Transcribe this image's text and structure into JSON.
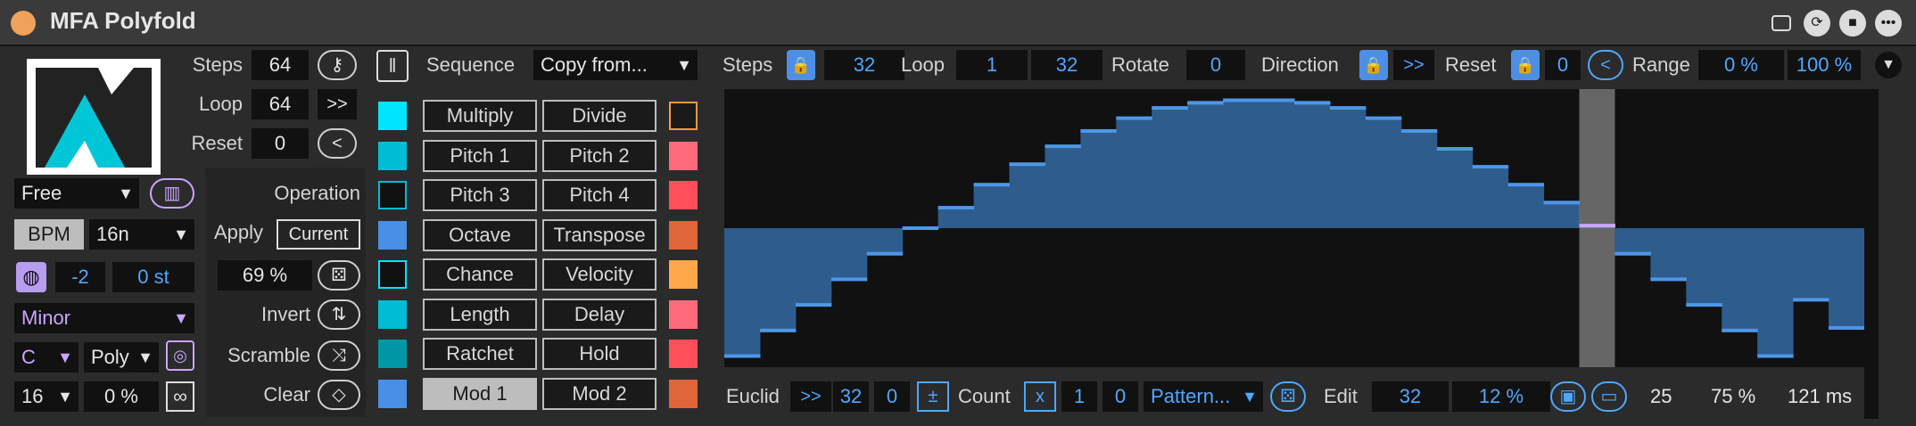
{
  "title": "MFA Polyfold",
  "colors": {
    "accent": "#4ea8ff",
    "bar": "#2e5c8c",
    "bar_top": "#4e97e8",
    "playhead": "#8a8a8a",
    "highlight": "#c9a6ff"
  },
  "left": {
    "steps_label": "Steps",
    "steps": "64",
    "loop_label": "Loop",
    "loop": "64",
    "loop_dir": ">>",
    "reset_label": "Reset",
    "reset": "0",
    "reset_dir": "<",
    "sync": "Free",
    "bpm": "BPM",
    "rate": "16n",
    "transpose": "-2",
    "semitones": "0 st",
    "scale": "Minor",
    "key": "C",
    "voice": "Poly",
    "length": "16",
    "percent": "0 %",
    "inf": "∞",
    "operation_label": "Operation",
    "apply_label": "Apply",
    "apply_value": "Current",
    "amount": "69 %",
    "invert_label": "Invert",
    "scramble_label": "Scramble",
    "clear_label": "Clear"
  },
  "sequence": {
    "label": "Sequence",
    "copy": "Copy from..."
  },
  "ops": [
    {
      "a": "Multiply",
      "b": "Divide",
      "ca": "#00e5ff",
      "cb": "#1a1a1a",
      "cbb": "#ff9a3c"
    },
    {
      "a": "Pitch 1",
      "b": "Pitch 2",
      "ca": "#00bcd4",
      "cb": "#ff6b7a"
    },
    {
      "a": "Pitch 3",
      "b": "Pitch 4",
      "ca": "#111111",
      "cab": "#00bcd4",
      "cb": "#ff4f5a"
    },
    {
      "a": "Octave",
      "b": "Transpose",
      "ca": "#4a8fe6",
      "cb": "#e0653a"
    },
    {
      "a": "Chance",
      "b": "Velocity",
      "ca": "#111111",
      "cab": "#00e5ff",
      "cb": "#ffa84a"
    },
    {
      "a": "Length",
      "b": "Delay",
      "ca": "#00bcd4",
      "cb": "#ff6b7a"
    },
    {
      "a": "Ratchet",
      "b": "Hold",
      "ca": "#0097a7",
      "cb": "#ff4f5a"
    },
    {
      "a": "Mod 1",
      "b": "Mod 2",
      "ca": "#4a8fe6",
      "cb": "#e0653a",
      "sel": true
    }
  ],
  "top": {
    "steps_label": "Steps",
    "steps": "32",
    "loop_label": "Loop",
    "loop_start": "1",
    "loop_end": "32",
    "rotate_label": "Rotate",
    "rotate": "0",
    "direction_label": "Direction",
    "direction": ">>",
    "reset_label": "Reset",
    "reset": "0",
    "reset_dir": "<",
    "range_label": "Range",
    "range_lo": "0 %",
    "range_hi": "100 %"
  },
  "bottom": {
    "euclid_label": "Euclid",
    "euclid_dir": ">>",
    "euclid_steps": "32",
    "euclid_val": "0",
    "pm": "±",
    "count_label": "Count",
    "count_x": "x",
    "count_a": "1",
    "count_b": "0",
    "pattern": "Pattern...",
    "edit_label": "Edit",
    "edit_val": "32",
    "edit_pct": "12 %",
    "stat_a": "25",
    "stat_b": "75 %",
    "stat_c": "121 ms"
  },
  "chart_data": {
    "type": "bar",
    "baseline": 0.5,
    "values": [
      0.0,
      0.1,
      0.2,
      0.3,
      0.4,
      0.5,
      0.58,
      0.67,
      0.75,
      0.82,
      0.88,
      0.93,
      0.97,
      0.99,
      1.0,
      1.0,
      0.99,
      0.97,
      0.93,
      0.88,
      0.81,
      0.74,
      0.67,
      0.6,
      0.51,
      0.4,
      0.3,
      0.2,
      0.1,
      0.0,
      0.22,
      0.11
    ],
    "playhead_index": 24
  }
}
